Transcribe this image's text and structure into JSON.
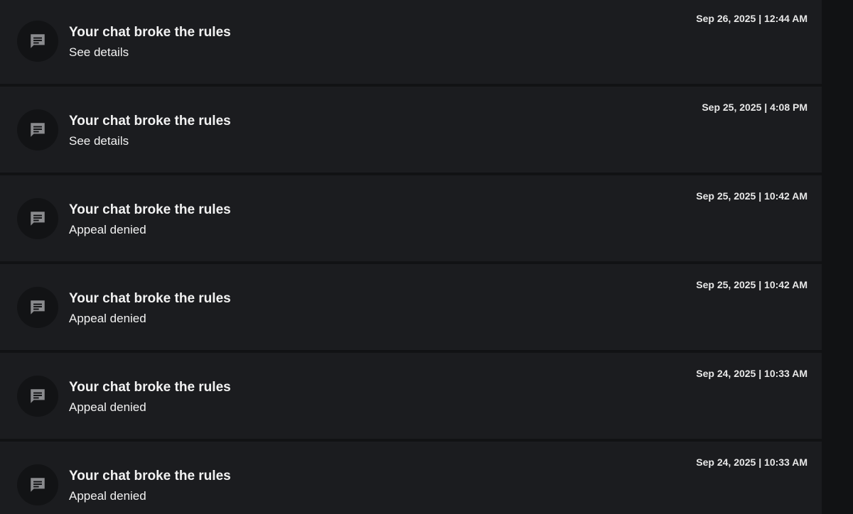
{
  "notifications": [
    {
      "title": "Your chat broke the rules",
      "subtitle": "See details",
      "timestamp": "Sep 26, 2025 | 12:44 AM",
      "icon": "chat-icon"
    },
    {
      "title": "Your chat broke the rules",
      "subtitle": "See details",
      "timestamp": "Sep 25, 2025 | 4:08 PM",
      "icon": "chat-icon"
    },
    {
      "title": "Your chat broke the rules",
      "subtitle": "Appeal denied",
      "timestamp": "Sep 25, 2025 | 10:42 AM",
      "icon": "chat-icon"
    },
    {
      "title": "Your chat broke the rules",
      "subtitle": "Appeal denied",
      "timestamp": "Sep 25, 2025 | 10:42 AM",
      "icon": "chat-icon"
    },
    {
      "title": "Your chat broke the rules",
      "subtitle": "Appeal denied",
      "timestamp": "Sep 24, 2025 | 10:33 AM",
      "icon": "chat-icon"
    },
    {
      "title": "Your chat broke the rules",
      "subtitle": "Appeal denied",
      "timestamp": "Sep 24, 2025 | 10:33 AM",
      "icon": "chat-icon"
    }
  ],
  "colors": {
    "background": "#111214",
    "row": "#1b1c1f",
    "icon_circle": "#121315",
    "icon": "#8a8b8e",
    "text": "#f2f2f2"
  }
}
